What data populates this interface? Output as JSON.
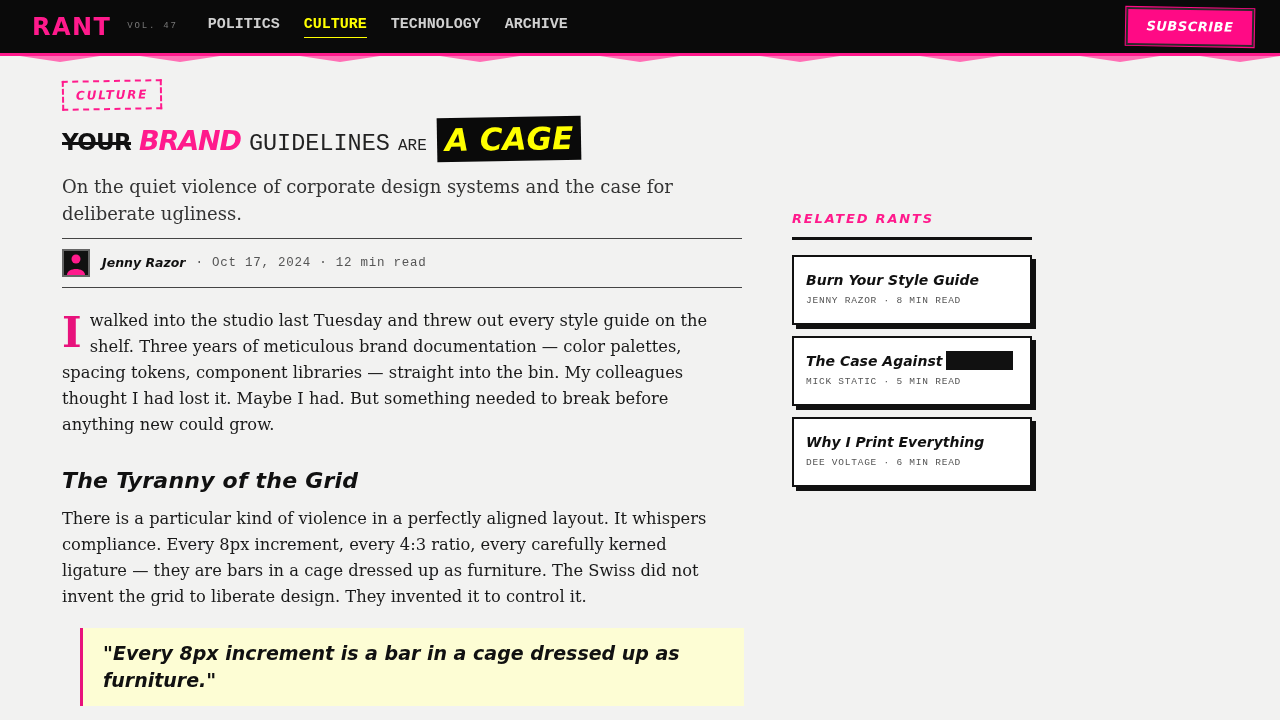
{
  "header": {
    "logo": "RANT",
    "volume": "VOL. 47",
    "nav": [
      {
        "label": "POLITICS",
        "selected": false
      },
      {
        "label": "CULTURE",
        "selected": true
      },
      {
        "label": "TECHNOLOGY",
        "selected": false
      },
      {
        "label": "ARCHIVE",
        "selected": false
      }
    ],
    "subscribe": "SUBSCRIBE"
  },
  "article": {
    "tag": "CULTURE",
    "title": [
      {
        "kind": "struck",
        "text": "YOUR"
      },
      {
        "kind": "marker",
        "text": "BRAND"
      },
      {
        "kind": "typewriter",
        "text": "GUIDELINES"
      },
      {
        "kind": "small",
        "text": "ARE"
      },
      {
        "kind": "highlight",
        "text": "A CAGE"
      }
    ],
    "subtitle": "On the quiet violence of corporate design systems and the case for deliberate ugliness.",
    "byline": {
      "author": "Jenny Razor",
      "meta": "· Oct 17, 2024 · 12 min read"
    },
    "body": [
      {
        "kind": "paragraph",
        "drop_cap": "I",
        "text": "walked into the studio last Tuesday and threw out every style guide on the shelf. Three years of meticulous brand documentation — color palettes, spacing tokens, component libraries — straight into the bin. My colleagues thought I had lost it. Maybe I had. But something needed to break before anything new could grow."
      },
      {
        "kind": "heading",
        "text": "The Tyranny of the Grid"
      },
      {
        "kind": "paragraph",
        "text": "There is a particular kind of violence in a perfectly aligned layout. It whispers compliance. Every 8px increment, every 4:3 ratio, every carefully kerned ligature — they are bars in a cage dressed up as furniture. The Swiss did not invent the grid to liberate design. They invented it to control it."
      },
      {
        "kind": "quote",
        "text": "\"Every 8px increment is a bar in a cage dressed up as furniture.\""
      }
    ]
  },
  "related": {
    "heading": "RELATED RANTS",
    "items": [
      {
        "title": "Burn Your Style Guide",
        "redacted": false,
        "meta": "JENNY RAZOR · 8 MIN READ"
      },
      {
        "title": "The Case Against",
        "redacted": true,
        "meta": "MICK STATIC · 5 MIN READ"
      },
      {
        "title": "Why I Print Everything",
        "redacted": false,
        "meta": "DEE VOLTAGE · 6 MIN READ"
      }
    ]
  }
}
